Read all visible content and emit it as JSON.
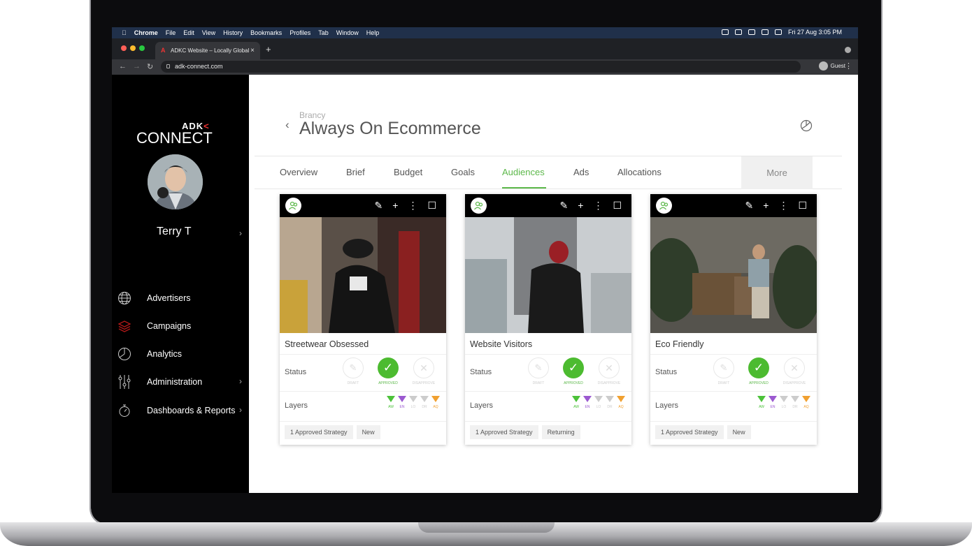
{
  "menubar": {
    "apple": "",
    "items": [
      "Chrome",
      "File",
      "Edit",
      "View",
      "History",
      "Bookmarks",
      "Profiles",
      "Tab",
      "Window",
      "Help"
    ],
    "datetime": "Fri 27 Aug  3:05 PM"
  },
  "browser": {
    "tab_title": "ADKC Website – Locally Global",
    "url": "adk-connect.com",
    "profile": "Guest"
  },
  "sidebar": {
    "logo_small": "ADK",
    "logo_big": "CONNECT",
    "user_name": "Terry T",
    "items": [
      {
        "label": "Advertisers",
        "icon": "globe-icon"
      },
      {
        "label": "Campaigns",
        "icon": "layers-icon"
      },
      {
        "label": "Analytics",
        "icon": "pie-chart-icon"
      },
      {
        "label": "Administration",
        "icon": "sliders-icon"
      },
      {
        "label": "Dashboards & Reports",
        "icon": "stopwatch-icon"
      }
    ]
  },
  "header": {
    "breadcrumb": "Brancy",
    "title": "Always On Ecommerce"
  },
  "tabs": [
    "Overview",
    "Brief",
    "Budget",
    "Goals",
    "Audiences",
    "Ads",
    "Allocations"
  ],
  "active_tab": "Audiences",
  "more_label": "More",
  "status_labels": {
    "status": "Status",
    "layers": "Layers",
    "draft": "DRAFT",
    "approved": "APPROVED",
    "disapprove": "DISAPPROVE"
  },
  "layer_labels": [
    "AW",
    "EN",
    "LO",
    "DR",
    "AQ"
  ],
  "colors": {
    "accent": "#5cb84a",
    "aw": "#4cc23a",
    "en": "#9b59d0",
    "aq": "#f0a030"
  },
  "cards": [
    {
      "name": "Streetwear Obsessed",
      "strategy": "1 Approved Strategy",
      "tag": "New"
    },
    {
      "name": "Website Visitors",
      "strategy": "1 Approved Strategy",
      "tag": "Returning"
    },
    {
      "name": "Eco Friendly",
      "strategy": "1 Approved Strategy",
      "tag": "New"
    }
  ]
}
